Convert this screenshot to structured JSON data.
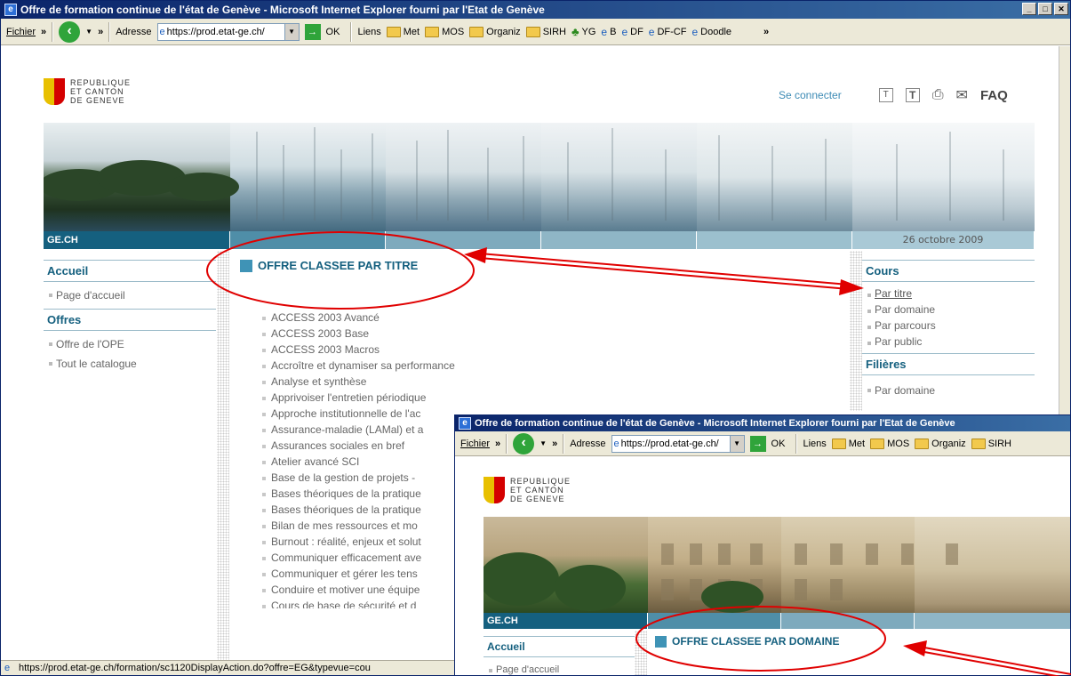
{
  "window1": {
    "title": "Offre de formation continue de l'état de Genève - Microsoft Internet Explorer fourni par l'Etat de Genève",
    "menu_fichier": "Fichier",
    "address_label": "Adresse",
    "address_value": "https://prod.etat-ge.ch/",
    "go_label": "OK",
    "links_label": "Liens",
    "links": [
      "Met",
      "MOS",
      "Organiz",
      "SIRH",
      "YG",
      "B",
      "DF",
      "DF-CF",
      "Doodle"
    ],
    "status_url": "https://prod.etat-ge.ch/formation/sc1120DisplayAction.do?offre=EG&typevue=cou"
  },
  "site": {
    "logo_lines": [
      "REPUBLIQUE",
      "ET CANTON",
      "DE GENEVE"
    ],
    "connect": "Se connecter",
    "tool_t1": "T",
    "tool_t2": "T",
    "faq": "FAQ",
    "gech": "GE.CH",
    "date": "26 octobre 2009"
  },
  "left_nav": {
    "accueil": "Accueil",
    "page_accueil": "Page d'accueil",
    "offres": "Offres",
    "offre_ope": "Offre de l'OPE",
    "catalogue": "Tout le catalogue"
  },
  "main": {
    "section_title": "OFFRE CLASSEE PAR TITRE",
    "courses": [
      "ACCESS 2003 Avancé",
      "ACCESS 2003 Base",
      "ACCESS 2003 Macros",
      "Accroître et dynamiser sa performance",
      "Analyse et synthèse",
      "Apprivoiser l'entretien périodique",
      "Approche institutionnelle de l'ac",
      "Assurance-maladie (LAMal) et a",
      "Assurances sociales en bref",
      "Atelier avancé SCI",
      "Base de la gestion de projets -",
      "Bases théoriques de la pratique",
      "Bases théoriques de la pratique",
      "Bilan de mes ressources et mo",
      "Burnout : réalité, enjeux et solut",
      "Communiquer efficacement ave",
      "Communiquer et gérer les tens",
      "Conduire et motiver une équipe",
      "Cours de base de sécurité et d"
    ]
  },
  "right_nav": {
    "cours": "Cours",
    "par_titre": "Par titre",
    "par_domaine": "Par domaine",
    "par_parcours": "Par parcours",
    "par_public": "Par public",
    "filieres": "Filières",
    "filieres_par_domaine": "Par domaine"
  },
  "window2": {
    "title": "Offre de formation continue de l'état de Genève - Microsoft Internet Explorer fourni par l'Etat de Genève",
    "menu_fichier": "Fichier",
    "address_label": "Adresse",
    "address_value": "https://prod.etat-ge.ch/",
    "go_label": "OK",
    "links_label": "Liens",
    "links": [
      "Met",
      "MOS",
      "Organiz",
      "SIRH"
    ],
    "logo_lines": [
      "REPUBLIQUE",
      "ET CANTON",
      "DE GENEVE"
    ],
    "gech": "GE.CH",
    "accueil": "Accueil",
    "page_accueil": "Page d'accueil",
    "section_title": "OFFRE CLASSEE PAR DOMAINE"
  },
  "colors": {
    "accent": "#15607f",
    "annotation_red": "#e00000",
    "title_bar": "#0a246a"
  }
}
